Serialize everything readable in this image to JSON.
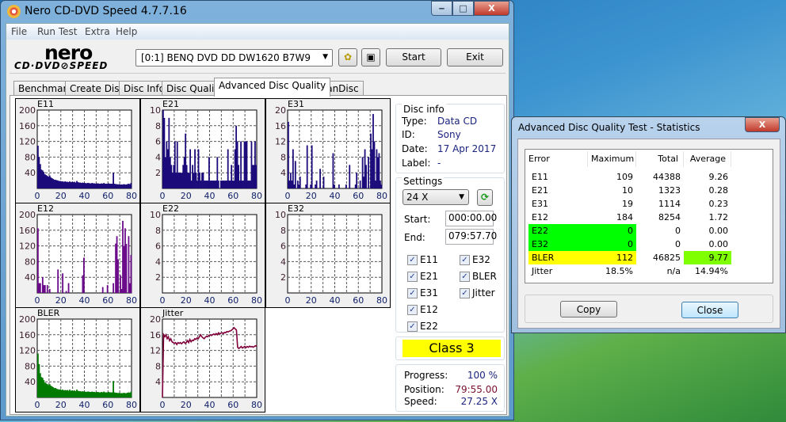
{
  "window": {
    "title": "Nero CD-DVD Speed 4.7.7.16",
    "minimize": "‒",
    "maximize": "□",
    "close": "X"
  },
  "menu": [
    "File",
    "Run Test",
    "Extra",
    "Help"
  ],
  "logo": {
    "line1": "nero",
    "line2": "CD·DVD⊘SPEED"
  },
  "toolbar": {
    "drive": "[0:1]   BENQ DVD DD DW1620 B7W9",
    "start": "Start",
    "exit": "Exit"
  },
  "tabs": [
    "Benchmark",
    "Create Disc",
    "Disc Info",
    "Disc Quality",
    "Advanced Disc Quality",
    "ScanDisc"
  ],
  "active_tab": "Advanced Disc Quality",
  "disc_info": {
    "title": "Disc info",
    "type_label": "Type:",
    "type": "Data CD",
    "id_label": "ID:",
    "id": "Sony",
    "date_label": "Date:",
    "date": "17 Apr 2017",
    "label_label": "Label:",
    "label": "-"
  },
  "settings": {
    "title": "Settings",
    "speed": "24 X",
    "start_label": "Start:",
    "start": "000:00.00",
    "end_label": "End:",
    "end": "079:57.70",
    "checks": [
      {
        "label": "E11",
        "checked": true
      },
      {
        "label": "E21",
        "checked": true
      },
      {
        "label": "E31",
        "checked": true
      },
      {
        "label": "E12",
        "checked": true
      },
      {
        "label": "E22",
        "checked": true
      },
      {
        "label": "E32",
        "checked": true
      },
      {
        "label": "BLER",
        "checked": true
      },
      {
        "label": "Jitter",
        "checked": true
      }
    ]
  },
  "class_label": "Class 3",
  "progress": {
    "progress_label": "Progress:",
    "progress": "100 %",
    "position_label": "Position:",
    "position": "79:55.00",
    "speed_label": "Speed:",
    "speed": "27.25 X"
  },
  "stats": {
    "title": "Advanced Disc Quality Test - Statistics",
    "headers": [
      "Error",
      "Maximum",
      "Total",
      "Average"
    ],
    "rows": [
      [
        "E11",
        "109",
        "44388",
        "9.26"
      ],
      [
        "E21",
        "10",
        "1323",
        "0.28"
      ],
      [
        "E31",
        "19",
        "1114",
        "0.23"
      ],
      [
        "E12",
        "184",
        "8254",
        "1.72"
      ],
      [
        "E22",
        "0",
        "0",
        "0.00"
      ],
      [
        "E32",
        "0",
        "0",
        "0.00"
      ],
      [
        "BLER",
        "112",
        "46825",
        "9.77"
      ],
      [
        "Jitter",
        "18.5%",
        "n/a",
        "14.94%"
      ]
    ],
    "highlight": {
      "E22": "#00ff00",
      "E32": "#00ff00",
      "BLER": "#ffff00",
      "BLER_avg": "#80ff00"
    },
    "copy": "Copy",
    "close": "Close"
  },
  "chart_data": [
    {
      "type": "bar",
      "title": "E11",
      "color": "#1a0a7a",
      "ylim": [
        0,
        200
      ],
      "yticks": [
        "200",
        "160",
        "120",
        "80",
        "40"
      ],
      "xticks": [
        "0",
        "20",
        "40",
        "60",
        "80"
      ],
      "xlim": [
        0,
        80
      ],
      "values": [
        109,
        80,
        62,
        48,
        46,
        42,
        36,
        34,
        32,
        30,
        33,
        28,
        26,
        24,
        22,
        22,
        21,
        20,
        19,
        19,
        18,
        18,
        17,
        18,
        17,
        17,
        16,
        18,
        16,
        17,
        16,
        17,
        15,
        19,
        16,
        15,
        15,
        14,
        15,
        14,
        14,
        13,
        14,
        14,
        13,
        13,
        14,
        13,
        13,
        12,
        13,
        13,
        12,
        12,
        13,
        12,
        14,
        12,
        12,
        12,
        13,
        12,
        12,
        12,
        40,
        12,
        11,
        11,
        10,
        11,
        10,
        10,
        10,
        11,
        10,
        10,
        11,
        12,
        11,
        14
      ]
    },
    {
      "type": "bar",
      "title": "E21",
      "color": "#1a0a7a",
      "ylim": [
        0,
        10
      ],
      "yticks": [
        "10",
        "8",
        "6",
        "4",
        "2"
      ],
      "xticks": [
        "0",
        "20",
        "40",
        "60",
        "80"
      ],
      "xlim": [
        0,
        80
      ],
      "values": [
        10,
        9,
        4,
        6,
        5,
        9,
        4,
        3,
        2,
        3,
        6,
        2,
        6,
        2,
        2,
        2,
        2,
        3,
        4,
        7,
        3,
        2,
        2,
        5,
        1,
        3,
        2,
        5,
        2,
        1,
        5,
        2,
        1,
        2,
        2,
        1,
        1,
        1,
        1,
        4,
        1,
        1,
        1,
        1,
        1,
        1,
        4,
        1,
        0,
        1,
        1,
        1,
        1,
        1,
        1,
        5,
        1,
        1,
        3,
        1,
        1,
        5,
        8,
        6,
        3,
        1,
        6,
        1,
        1,
        6,
        6,
        6,
        1,
        1,
        1,
        6,
        3,
        3,
        6,
        3
      ]
    },
    {
      "type": "bar",
      "title": "E31",
      "color": "#1a0a7a",
      "ylim": [
        0,
        20
      ],
      "yticks": [
        "20",
        "16",
        "12",
        "8",
        "4"
      ],
      "xticks": [
        "0",
        "20",
        "40",
        "60",
        "80"
      ],
      "xlim": [
        0,
        80
      ],
      "values": [
        17,
        2,
        4,
        2,
        10,
        1,
        7,
        0,
        2,
        1,
        3,
        0,
        0,
        0,
        0,
        1,
        11,
        0,
        0,
        1,
        11,
        0,
        0,
        1,
        2,
        0,
        0,
        5,
        0,
        0,
        3,
        0,
        0,
        0,
        0,
        0,
        0,
        0,
        9,
        1,
        0,
        0,
        0,
        1,
        0,
        0,
        0,
        0,
        0,
        1,
        0,
        0,
        6,
        0,
        0,
        0,
        0,
        1,
        4,
        0,
        0,
        2,
        0,
        8,
        3,
        10,
        6,
        0,
        8,
        0,
        14,
        10,
        19,
        12,
        2,
        10,
        8,
        9,
        2,
        1
      ]
    },
    {
      "type": "bar",
      "title": "E12",
      "color": "#6a0a8a",
      "ylim": [
        0,
        200
      ],
      "yticks": [
        "200",
        "160",
        "120",
        "80",
        "40"
      ],
      "xticks": [
        "0",
        "20",
        "40",
        "60",
        "80"
      ],
      "xlim": [
        0,
        80
      ],
      "values": [
        165,
        25,
        25,
        0,
        40,
        20,
        20,
        0,
        20,
        0,
        10,
        0,
        0,
        0,
        0,
        0,
        0,
        60,
        0,
        0,
        0,
        50,
        0,
        0,
        5,
        0,
        25,
        0,
        0,
        0,
        0,
        0,
        0,
        0,
        0,
        0,
        0,
        0,
        45,
        90,
        0,
        0,
        0,
        0,
        0,
        0,
        0,
        0,
        0,
        0,
        0,
        0,
        0,
        0,
        0,
        15,
        0,
        0,
        0,
        20,
        0,
        0,
        0,
        0,
        25,
        0,
        126,
        145,
        86,
        0,
        45,
        10,
        184,
        120,
        165,
        125,
        0,
        145,
        25,
        97
      ]
    },
    {
      "type": "bar",
      "title": "E22",
      "color": "#1a0a7a",
      "ylim": [
        0,
        10
      ],
      "yticks": [
        "10",
        "8",
        "6",
        "4",
        "2"
      ],
      "xticks": [
        "0",
        "20",
        "40",
        "60",
        "80"
      ],
      "xlim": [
        0,
        80
      ],
      "values": []
    },
    {
      "type": "bar",
      "title": "E32",
      "color": "#1a0a7a",
      "ylim": [
        0,
        10
      ],
      "yticks": [
        "10",
        "8",
        "6",
        "4",
        "2"
      ],
      "xticks": [
        "0",
        "20",
        "40",
        "60",
        "80"
      ],
      "xlim": [
        0,
        80
      ],
      "values": []
    },
    {
      "type": "bar",
      "title": "BLER",
      "color": "#007a00",
      "ylim": [
        0,
        200
      ],
      "yticks": [
        "200",
        "160",
        "120",
        "80",
        "40"
      ],
      "xticks": [
        "0",
        "20",
        "40",
        "60",
        "80"
      ],
      "xlim": [
        0,
        80
      ],
      "values": [
        112,
        85,
        62,
        52,
        50,
        44,
        38,
        36,
        34,
        32,
        34,
        30,
        28,
        26,
        24,
        24,
        22,
        21,
        20,
        21,
        19,
        20,
        18,
        19,
        18,
        19,
        17,
        20,
        17,
        18,
        17,
        18,
        16,
        20,
        17,
        16,
        16,
        15,
        16,
        15,
        15,
        14,
        15,
        15,
        14,
        14,
        15,
        14,
        14,
        13,
        14,
        14,
        13,
        13,
        14,
        13,
        15,
        13,
        13,
        13,
        14,
        13,
        13,
        13,
        42,
        13,
        12,
        12,
        11,
        12,
        11,
        11,
        11,
        12,
        11,
        11,
        12,
        13,
        12,
        15
      ]
    },
    {
      "type": "line",
      "title": "Jitter",
      "color": "#80003a",
      "ylim": [
        0,
        20
      ],
      "yticks": [
        "20",
        "16",
        "12",
        "8",
        "4"
      ],
      "xticks": [
        "0",
        "20",
        "40",
        "60",
        "80"
      ],
      "xlim": [
        0,
        80
      ],
      "values": [
        0,
        16,
        15.5,
        16,
        15,
        15.5,
        14.5,
        15,
        14.2,
        14,
        13.8,
        14,
        13.5,
        14,
        13.8,
        14,
        13.7,
        14,
        14.2,
        13.8,
        14,
        14.5,
        14,
        14.8,
        14.2,
        14.6,
        14.5,
        15,
        14.8,
        15.2,
        15,
        15.5,
        16,
        15.5,
        15.2,
        15,
        15.4,
        15.6,
        15.5,
        15.8,
        16,
        15.8,
        16,
        16.2,
        16,
        16.3,
        16,
        16.5,
        16.2,
        16.4,
        16.5,
        16.3,
        16.6,
        16.5,
        16.8,
        16.7,
        16.9,
        17,
        17.2,
        17.5,
        17.8,
        17.5,
        17.2,
        12.8,
        12.5,
        12.7,
        13,
        12.6,
        12.8,
        13,
        12.7,
        13,
        12.8,
        13.1,
        12.9,
        13,
        12.8,
        13,
        13.2,
        13
      ]
    }
  ]
}
